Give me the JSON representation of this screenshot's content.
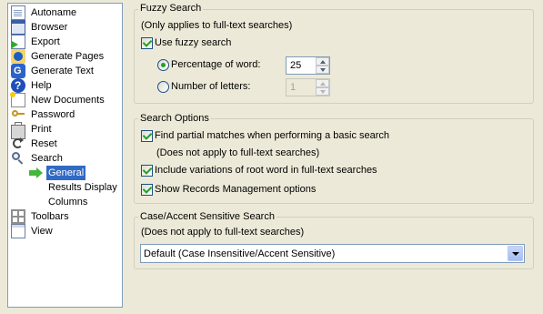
{
  "tree": {
    "items": [
      {
        "label": "Autoname",
        "icon": "document-icon"
      },
      {
        "label": "Browser",
        "icon": "browser-icon"
      },
      {
        "label": "Export",
        "icon": "export-icon"
      },
      {
        "label": "Generate Pages",
        "icon": "generate-pages-icon"
      },
      {
        "label": "Generate Text",
        "icon": "generate-text-icon"
      },
      {
        "label": "Help",
        "icon": "help-icon"
      },
      {
        "label": "New Documents",
        "icon": "new-document-icon"
      },
      {
        "label": "Password",
        "icon": "key-icon"
      },
      {
        "label": "Print",
        "icon": "printer-icon"
      },
      {
        "label": "Reset",
        "icon": "reset-icon"
      },
      {
        "label": "Search",
        "icon": "search-icon"
      },
      {
        "label": "General",
        "icon": "arrow-right-icon",
        "selected": true
      },
      {
        "label": "Results Display"
      },
      {
        "label": "Columns"
      },
      {
        "label": "Toolbars",
        "icon": "toolbar-icon"
      },
      {
        "label": "View",
        "icon": "view-icon"
      }
    ]
  },
  "fuzzy": {
    "title": "Fuzzy Search",
    "note": "(Only applies to full-text searches)",
    "use_fuzzy_label": "Use fuzzy search",
    "use_fuzzy_checked": true,
    "percentage_label": "Percentage of word:",
    "percentage_value": "25",
    "percentage_selected": true,
    "letters_label": "Number of letters:",
    "letters_value": "1",
    "letters_selected": false
  },
  "options": {
    "title": "Search Options",
    "partial_label": "Find partial matches when performing a basic search",
    "partial_checked": true,
    "partial_note": "(Does not apply to full-text searches)",
    "variations_label": "Include variations of root word in full-text searches",
    "variations_checked": true,
    "records_label": "Show Records Management options",
    "records_checked": true
  },
  "sensitive": {
    "title": "Case/Accent Sensitive Search",
    "note": "(Does not apply to full-text searches)",
    "selected": "Default (Case Insensitive/Accent Sensitive)"
  }
}
